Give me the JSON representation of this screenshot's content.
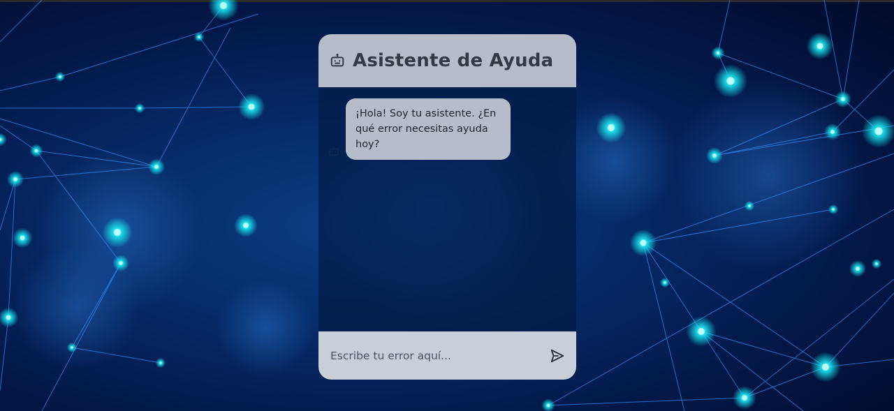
{
  "page": {
    "background_colors": [
      "#0a3f86",
      "#062a66",
      "#03184a",
      "#020b2a"
    ],
    "network_accent": "#19e6f0",
    "network_line": "#2e8cf2"
  },
  "chat": {
    "title": "Asistente de Ayuda",
    "title_icon": "robot-icon",
    "header_color": "#b6bdc9",
    "messages": [
      {
        "sender": "bot",
        "avatar_icon": "robot-icon",
        "text": "¡Hola! Soy tu asistente. ¿En qué error necesitas ayuda hoy?"
      }
    ],
    "input": {
      "placeholder": "Escribe tu error aquí...",
      "value": "",
      "send_icon": "send-icon"
    }
  }
}
